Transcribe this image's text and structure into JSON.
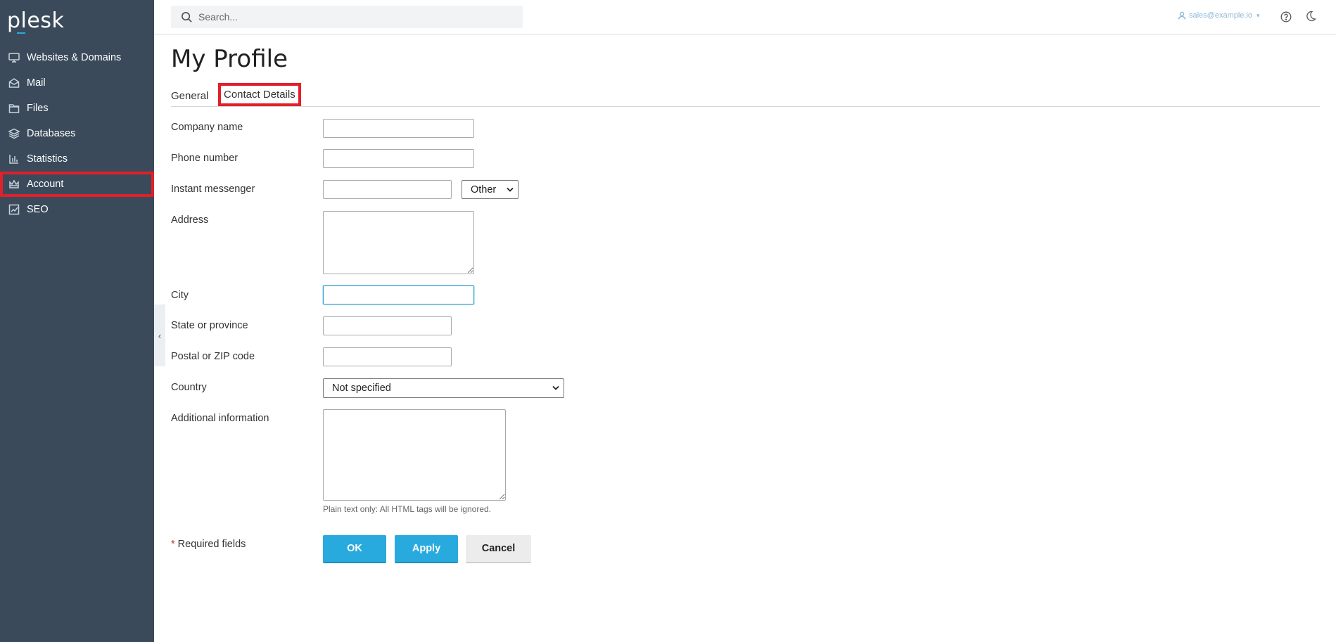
{
  "brand": {
    "logo_text": "plesk",
    "accent": "#28aade",
    "sidebar_bg": "#3a4a5a"
  },
  "sidebar": {
    "items": [
      {
        "label": "Websites & Domains",
        "icon": "monitor-icon"
      },
      {
        "label": "Mail",
        "icon": "envelope-icon"
      },
      {
        "label": "Files",
        "icon": "folder-icon"
      },
      {
        "label": "Databases",
        "icon": "layers-icon"
      },
      {
        "label": "Statistics",
        "icon": "bar-chart-icon"
      },
      {
        "label": "Account",
        "icon": "crown-icon"
      },
      {
        "label": "SEO",
        "icon": "trend-chart-icon"
      }
    ]
  },
  "topbar": {
    "search_placeholder": "Search...",
    "user_label": "sales@example.io"
  },
  "page": {
    "title": "My Profile"
  },
  "tabs": [
    {
      "label": "General"
    },
    {
      "label": "Contact Details"
    }
  ],
  "form": {
    "company_label": "Company name",
    "phone_label": "Phone number",
    "messenger_label": "Instant messenger",
    "messenger_type": "Other",
    "address_label": "Address",
    "city_label": "City",
    "state_label": "State or province",
    "postal_label": "Postal or ZIP code",
    "country_label": "Country",
    "country_value": "Not specified",
    "additional_label": "Additional information",
    "additional_hint": "Plain text only: All HTML tags will be ignored.",
    "required_star": "*",
    "required_label": "Required fields"
  },
  "buttons": {
    "ok": "OK",
    "apply": "Apply",
    "cancel": "Cancel"
  }
}
